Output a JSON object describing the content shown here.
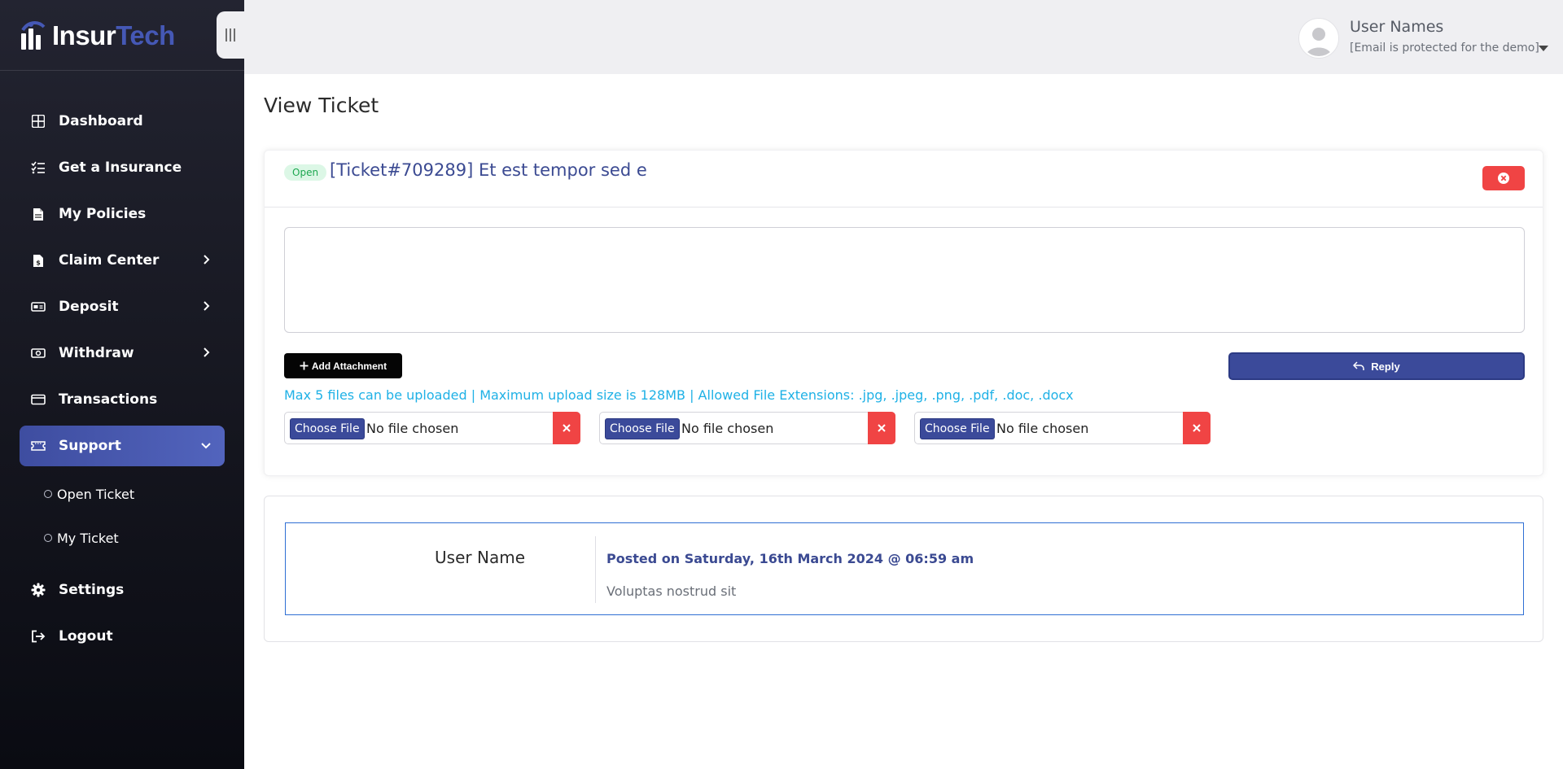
{
  "brand": {
    "part1": "Insur",
    "part2": "Tech"
  },
  "sidebar": {
    "items": [
      {
        "label": "Dashboard",
        "icon": "dashboard-icon"
      },
      {
        "label": "Get a Insurance",
        "icon": "checklist-icon"
      },
      {
        "label": "My Policies",
        "icon": "document-icon"
      },
      {
        "label": "Claim Center",
        "icon": "claim-file-icon"
      },
      {
        "label": "Deposit",
        "icon": "deposit-icon"
      },
      {
        "label": "Withdraw",
        "icon": "cash-icon"
      },
      {
        "label": "Transactions",
        "icon": "card-icon"
      },
      {
        "label": "Support",
        "icon": "ticket-icon"
      },
      {
        "label": "Settings",
        "icon": "gear-icon"
      },
      {
        "label": "Logout",
        "icon": "logout-icon"
      }
    ],
    "support_sub": [
      {
        "label": "Open Ticket"
      },
      {
        "label": "My Ticket"
      }
    ]
  },
  "header": {
    "user_name": "User Names",
    "user_email": "[Email is protected for the demo]"
  },
  "page": {
    "title": "View Ticket"
  },
  "ticket": {
    "status": "Open",
    "title": "[Ticket#709289] Et est tempor sed e",
    "add_attachment_label": "Add Attachment",
    "reply_label": "Reply",
    "help_text": "Max 5 files can be uploaded | Maximum upload size is 128MB | Allowed File Extensions: .jpg, .jpeg, .png, .pdf, .doc, .docx",
    "files": [
      {
        "button": "Choose File",
        "status": "No file chosen"
      },
      {
        "button": "Choose File",
        "status": "No file chosen"
      },
      {
        "button": "Choose File",
        "status": "No file chosen"
      }
    ]
  },
  "message": {
    "author": "User Name",
    "posted": "Posted on Saturday, 16th March 2024 @ 06:59 am",
    "body": "Voluptas nostrud sit"
  },
  "colors": {
    "primary": "#3b4a9a",
    "danger": "#f04444",
    "info": "#1fb1e6",
    "success": "#1ca74f"
  }
}
